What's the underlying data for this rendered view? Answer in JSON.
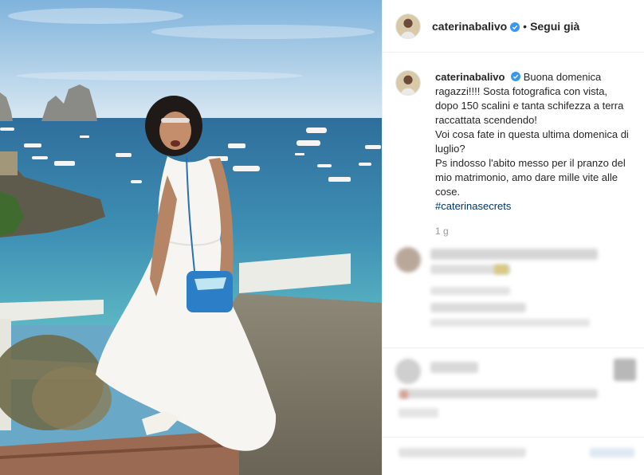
{
  "post": {
    "username": "caterinabalivo",
    "follow_label": "Segui già",
    "separator": "•",
    "caption_lines": "Buona domenica ragazzi!!!! Sosta fotografica con vista, dopo 150 scalini e tanta schifezza a terra raccattata scendendo!\nVoi cosa fate in questa ultima domenica di luglio?\nPs indosso l'abito messo per il pranzo del mio matrimonio, amo dare mille vite alle cose.",
    "hashtag": "#caterinasecrets",
    "time": "1 g"
  },
  "colors": {
    "verified": "#3897f0",
    "hashtag": "#003569",
    "time": "#999999"
  },
  "icons": {
    "verified": "verified-badge-icon"
  }
}
